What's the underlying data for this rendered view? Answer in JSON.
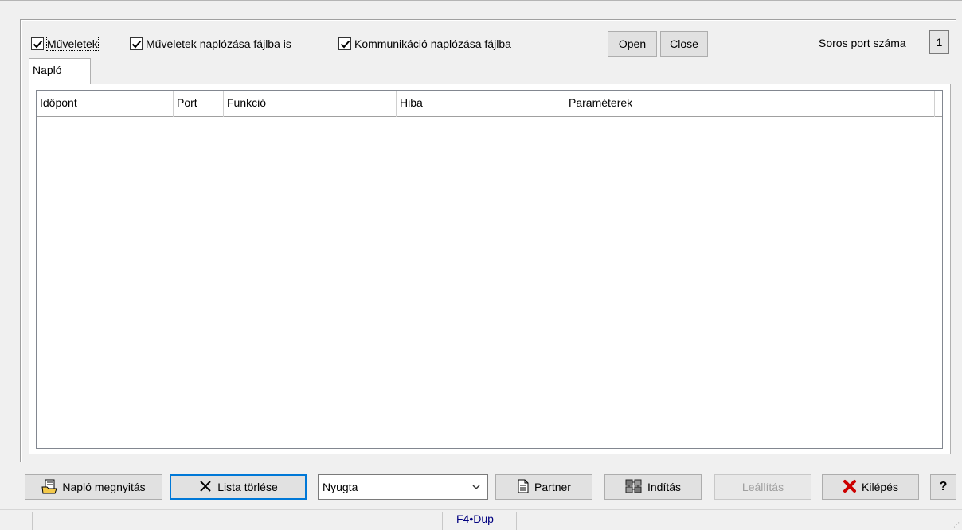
{
  "options": {
    "muveletek": "Műveletek",
    "log_to_file": "Műveletek naplózása fájlba is",
    "comm_log": "Kommunikáció naplózása fájlba"
  },
  "port_buttons": {
    "open": "Open",
    "close": "Close"
  },
  "serial_port": {
    "label": "Soros port száma",
    "value": "1"
  },
  "tabs": [
    {
      "label": "Napló"
    }
  ],
  "table": {
    "columns": [
      "Időpont",
      "Port",
      "Funkció",
      "Hiba",
      "Paraméterek"
    ],
    "rows": []
  },
  "toolbar": {
    "open_log": "Napló megnyitás",
    "clear_list": "Lista törlése",
    "receipt_type": "Nyugta",
    "partner": "Partner",
    "start": "Indítás",
    "stop": "Leállítás",
    "exit": "Kilépés",
    "help": "?"
  },
  "statusbar": {
    "shortcut": "F4•Dup"
  },
  "icons": [
    "checkbox-check-icon",
    "open-log-icon",
    "clear-x-icon",
    "chevron-down-icon",
    "partner-document-icon",
    "start-icon",
    "exit-x-icon"
  ],
  "colors": {
    "exit_x": "#cc0000",
    "default_border": "#0078d7",
    "statusbar_text": "#000080"
  }
}
